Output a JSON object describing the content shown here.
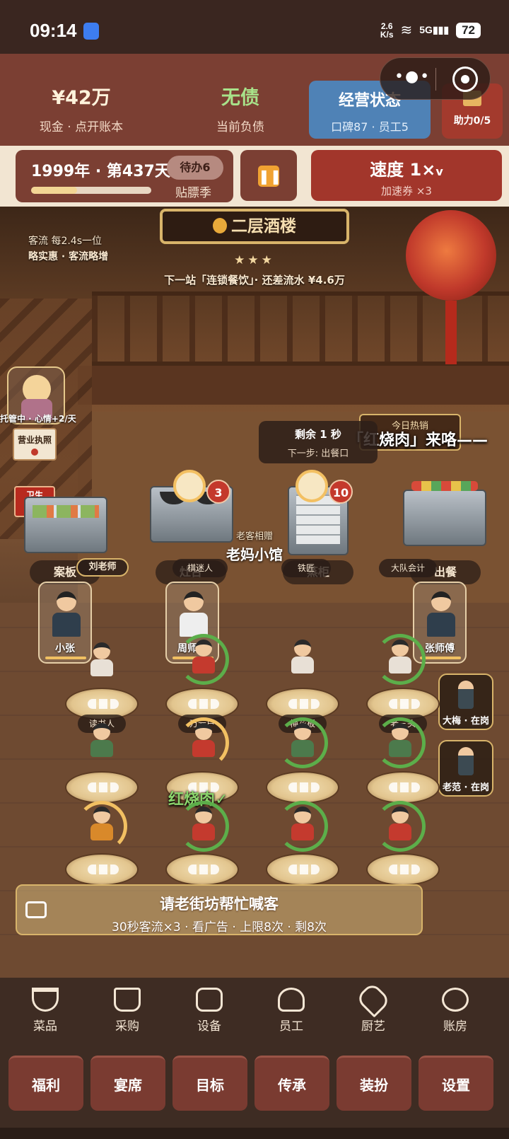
{
  "status_bar": {
    "time": "09:14",
    "net_speed_value": "2.6",
    "net_speed_unit": "K/s",
    "signal": "5G",
    "battery": "72"
  },
  "header": {
    "cash_value": "¥42万",
    "cash_label": "现金 · 点开账本",
    "debt_value": "无债",
    "debt_label": "当前负债",
    "status_title": "经营状态",
    "status_detail": "口碑87 · 员工5",
    "help_label": "助力0/5"
  },
  "controls": {
    "date": "1999年 · 第437天",
    "todo": "待办6",
    "season": "贴膘季",
    "day_progress": 0.38,
    "pause_icon": "pause-icon",
    "speed": "速度 1×",
    "speed_caret": "v",
    "speed_coupon": "加速券 ×3"
  },
  "scene": {
    "plaque": "二层酒楼",
    "stars": "★★★",
    "next_stop": "下一站「连锁餐饮」· 还差流水 ¥4.6万",
    "flow_line1": "客流 每2.4s一位",
    "flow_line2": "略实惠 · 客流略增",
    "manager_status": "托管中 · 心情+2/天",
    "license": "营业执照",
    "hygiene_line1": "卫生",
    "hygiene_line2": "红榜",
    "hot_title": "今日热销",
    "hot_dish": "「红烧肉」来咯——",
    "remain_title": "剩余 1 秒",
    "remain_next": "下一步: 出餐口",
    "gift_small": "老客相赠",
    "gift_big": "老妈小馆",
    "station_labels": [
      "案板",
      "灶台",
      "蒸柜",
      "出餐"
    ],
    "wok_badge": "3",
    "steam_badge": "10",
    "chef_labels": [
      "刘老师",
      "棋迷人",
      "铁匠",
      "大队会计"
    ],
    "staff": [
      "小张",
      "周师傅",
      "张师傅"
    ],
    "on_duty": [
      "大梅 · 在岗",
      "老范 · 在岗"
    ],
    "table_guests": [
      "读书人",
      "万元户",
      "梅花板",
      "老三头"
    ],
    "served": "红烧肉✓",
    "ad_title": "请老街坊帮忙喊客",
    "ad_detail": "30秒客流×3 · 看广告 · 上限8次 · 剩8次"
  },
  "nav": {
    "tabs": [
      "菜品",
      "采购",
      "设备",
      "员工",
      "厨艺",
      "账房"
    ],
    "buttons": [
      "福利",
      "宴席",
      "目标",
      "传承",
      "装扮",
      "设置"
    ]
  }
}
